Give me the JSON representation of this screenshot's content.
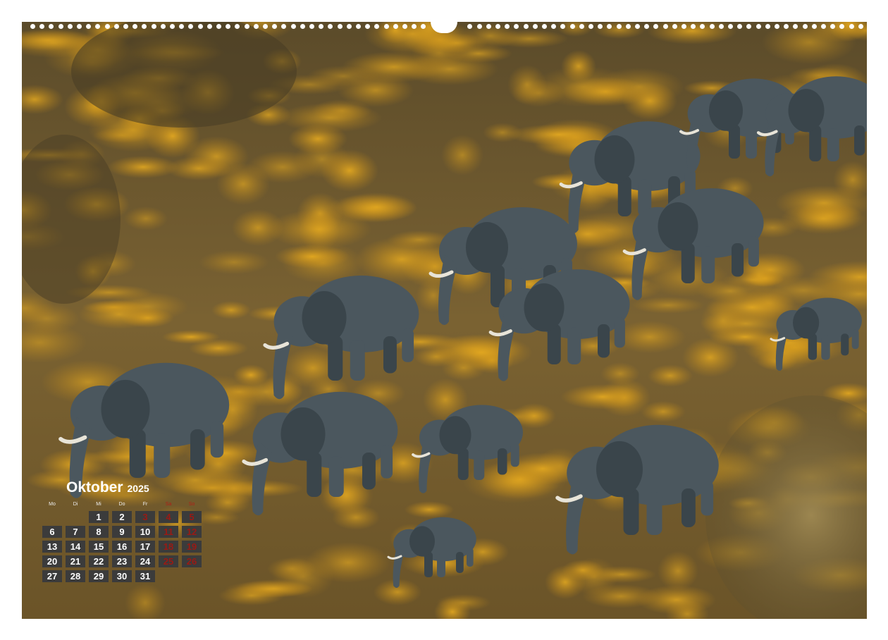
{
  "calendar": {
    "month": "Oktober",
    "year": "2025",
    "weekdays": [
      "Mo",
      "Di",
      "Mi",
      "Do",
      "Fr",
      "Sa",
      "So"
    ],
    "weeks": [
      [
        "",
        "",
        "1",
        "2",
        "3",
        "4",
        "5"
      ],
      [
        "6",
        "7",
        "8",
        "9",
        "10",
        "11",
        "12"
      ],
      [
        "13",
        "14",
        "15",
        "16",
        "17",
        "18",
        "19"
      ],
      [
        "20",
        "21",
        "22",
        "23",
        "24",
        "25",
        "26"
      ],
      [
        "27",
        "28",
        "29",
        "30",
        "31",
        "",
        ""
      ]
    ],
    "highlight_days": [
      "3"
    ],
    "colors": {
      "cell_bg": "#3b3b3b",
      "cell_text": "#ffffff",
      "weekend_text": "#9a1a14",
      "holiday_bg": "#7b1a14"
    }
  },
  "photo": {
    "subject": "elephant-herd-in-golden-grass",
    "colors": {
      "grass": "#d49a1c",
      "ground": "#6e5a2c",
      "elephant": "#4b575e"
    }
  }
}
